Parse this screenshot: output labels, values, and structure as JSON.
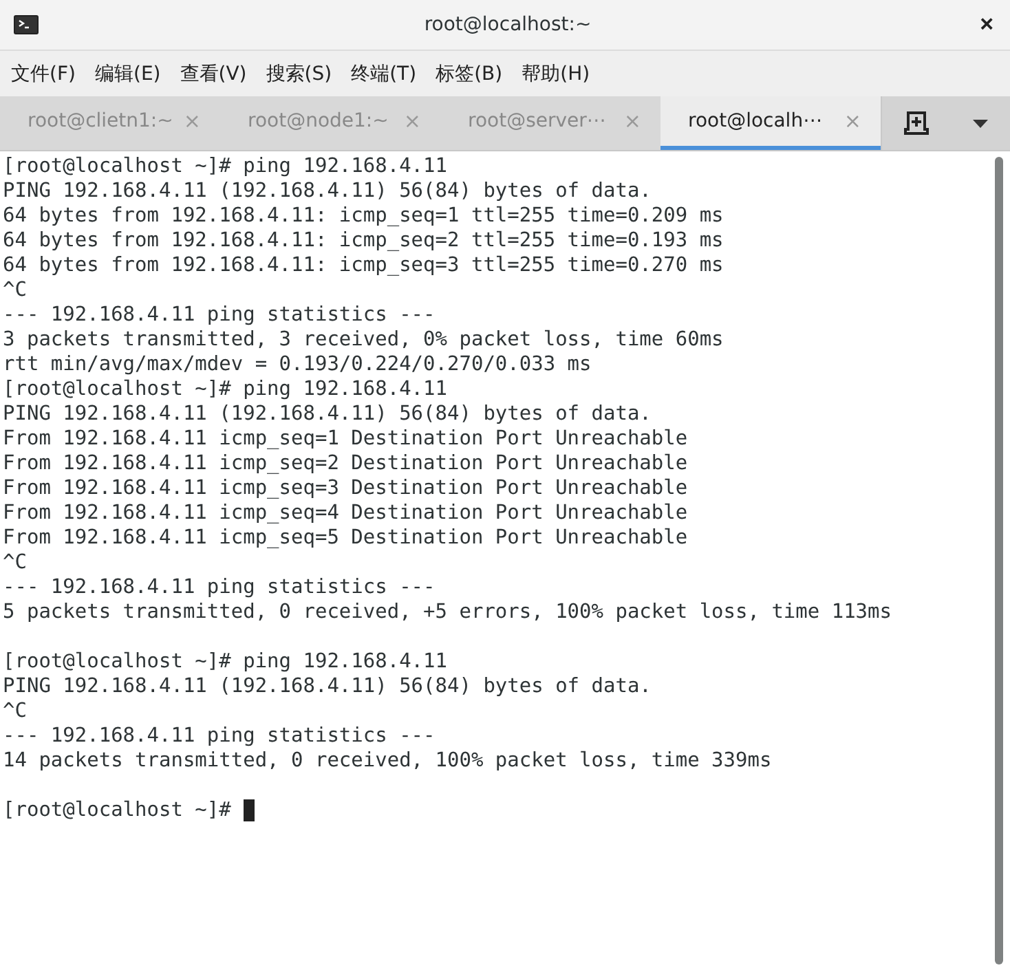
{
  "window": {
    "title": "root@localhost:~",
    "close": "×"
  },
  "menu": [
    "文件(F)",
    "编辑(E)",
    "查看(V)",
    "搜索(S)",
    "终端(T)",
    "标签(B)",
    "帮助(H)"
  ],
  "tabs": [
    {
      "label": "root@clietn1:~",
      "close": "×",
      "selected": false
    },
    {
      "label": "root@node1:~",
      "close": "×",
      "selected": false
    },
    {
      "label": "root@server⋯",
      "close": "×",
      "selected": false
    },
    {
      "label": "root@localh⋯",
      "close": "×",
      "selected": true
    }
  ],
  "terminal": {
    "lines": [
      {
        "kind": "text",
        "text": "[root@localhost ~]# ping 192.168.4.11"
      },
      {
        "kind": "text",
        "text": "PING 192.168.4.11 (192.168.4.11) 56(84) bytes of data."
      },
      {
        "kind": "text",
        "text": "64 bytes from 192.168.4.11: icmp_seq=1 ttl=255 time=0.209 ms"
      },
      {
        "kind": "text",
        "text": "64 bytes from 192.168.4.11: icmp_seq=2 ttl=255 time=0.193 ms"
      },
      {
        "kind": "text",
        "text": "64 bytes from 192.168.4.11: icmp_seq=3 ttl=255 time=0.270 ms"
      },
      {
        "kind": "text",
        "text": "^C"
      },
      {
        "kind": "text",
        "text": "--- 192.168.4.11 ping statistics ---"
      },
      {
        "kind": "text",
        "text": "3 packets transmitted, 3 received, 0% packet loss, time 60ms"
      },
      {
        "kind": "text",
        "text": "rtt min/avg/max/mdev = 0.193/0.224/0.270/0.033 ms"
      },
      {
        "kind": "text",
        "text": "[root@localhost ~]# ping 192.168.4.11"
      },
      {
        "kind": "text",
        "text": "PING 192.168.4.11 (192.168.4.11) 56(84) bytes of data."
      },
      {
        "kind": "text",
        "text": "From 192.168.4.11 icmp_seq=1 Destination Port Unreachable"
      },
      {
        "kind": "text",
        "text": "From 192.168.4.11 icmp_seq=2 Destination Port Unreachable"
      },
      {
        "kind": "text",
        "text": "From 192.168.4.11 icmp_seq=3 Destination Port Unreachable"
      },
      {
        "kind": "text",
        "text": "From 192.168.4.11 icmp_seq=4 Destination Port Unreachable"
      },
      {
        "kind": "text",
        "text": "From 192.168.4.11 icmp_seq=5 Destination Port Unreachable"
      },
      {
        "kind": "text",
        "text": "^C"
      },
      {
        "kind": "text",
        "text": "--- 192.168.4.11 ping statistics ---"
      },
      {
        "kind": "text",
        "text": "5 packets transmitted, 0 received, +5 errors, 100% packet loss, time 113ms"
      },
      {
        "kind": "blank"
      },
      {
        "kind": "text",
        "text": "[root@localhost ~]# ping 192.168.4.11"
      },
      {
        "kind": "text",
        "text": "PING 192.168.4.11 (192.168.4.11) 56(84) bytes of data."
      },
      {
        "kind": "text",
        "text": "^C"
      },
      {
        "kind": "text",
        "text": "--- 192.168.4.11 ping statistics ---"
      },
      {
        "kind": "text",
        "text": "14 packets transmitted, 0 received, 100% packet loss, time 339ms"
      },
      {
        "kind": "blank"
      },
      {
        "kind": "prompt",
        "text": "[root@localhost ~]#"
      }
    ]
  }
}
